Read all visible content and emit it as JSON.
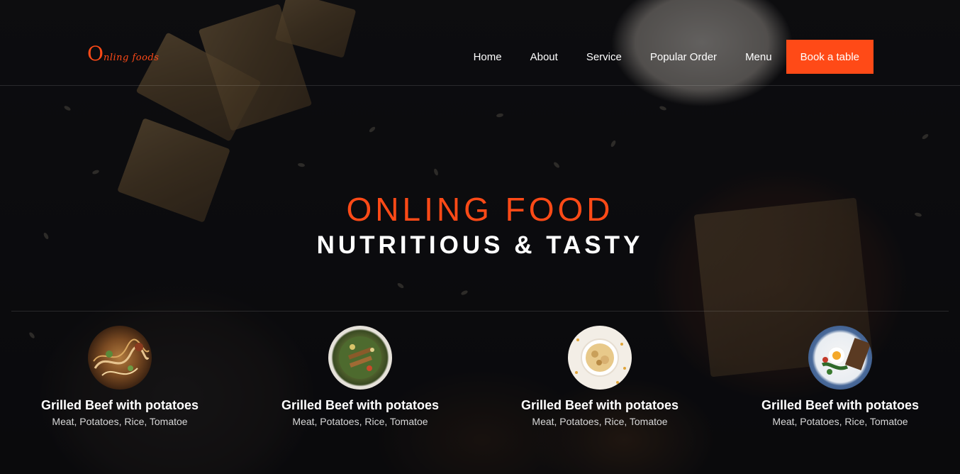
{
  "brand": {
    "logo_initial": "O",
    "logo_rest": "nling foods"
  },
  "nav": {
    "items": [
      {
        "label": "Home"
      },
      {
        "label": "About"
      },
      {
        "label": "Service"
      },
      {
        "label": "Popular Order"
      },
      {
        "label": "Menu"
      }
    ],
    "cta_label": "Book a table"
  },
  "hero": {
    "title": "ONLING FOOD",
    "subtitle": "NUTRITIOUS & TASTY"
  },
  "dishes": [
    {
      "name": "Grilled Beef with potatoes",
      "desc": "Meat, Potatoes, Rice, Tomatoe"
    },
    {
      "name": "Grilled Beef with potatoes",
      "desc": "Meat, Potatoes, Rice, Tomatoe"
    },
    {
      "name": "Grilled Beef with potatoes",
      "desc": "Meat, Potatoes, Rice, Tomatoe"
    },
    {
      "name": "Grilled Beef with potatoes",
      "desc": "Meat, Potatoes, Rice, Tomatoe"
    }
  ],
  "colors": {
    "accent": "#ff4a17",
    "background": "#0b0b0c",
    "text": "#ffffff"
  }
}
